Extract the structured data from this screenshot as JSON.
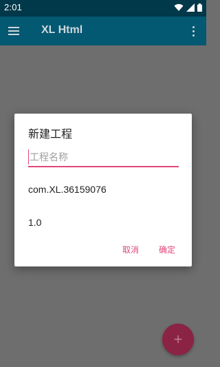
{
  "status_bar": {
    "time": "2:01",
    "icons": [
      "wifi-icon",
      "signal-icon",
      "battery-icon"
    ]
  },
  "app_bar": {
    "title": "XL Html",
    "menu_icon": "hamburger-menu-icon",
    "overflow_icon": "more-vert-icon",
    "background_color": "#035872"
  },
  "fab": {
    "label": "+",
    "icon": "add-icon"
  },
  "dialog": {
    "title": "新建工程",
    "name_input": {
      "value": "",
      "placeholder": "工程名称"
    },
    "package": "com.XL.36159076",
    "version": "1.0",
    "cancel_label": "取消",
    "ok_label": "确定",
    "accent_color": "#e0457b"
  }
}
